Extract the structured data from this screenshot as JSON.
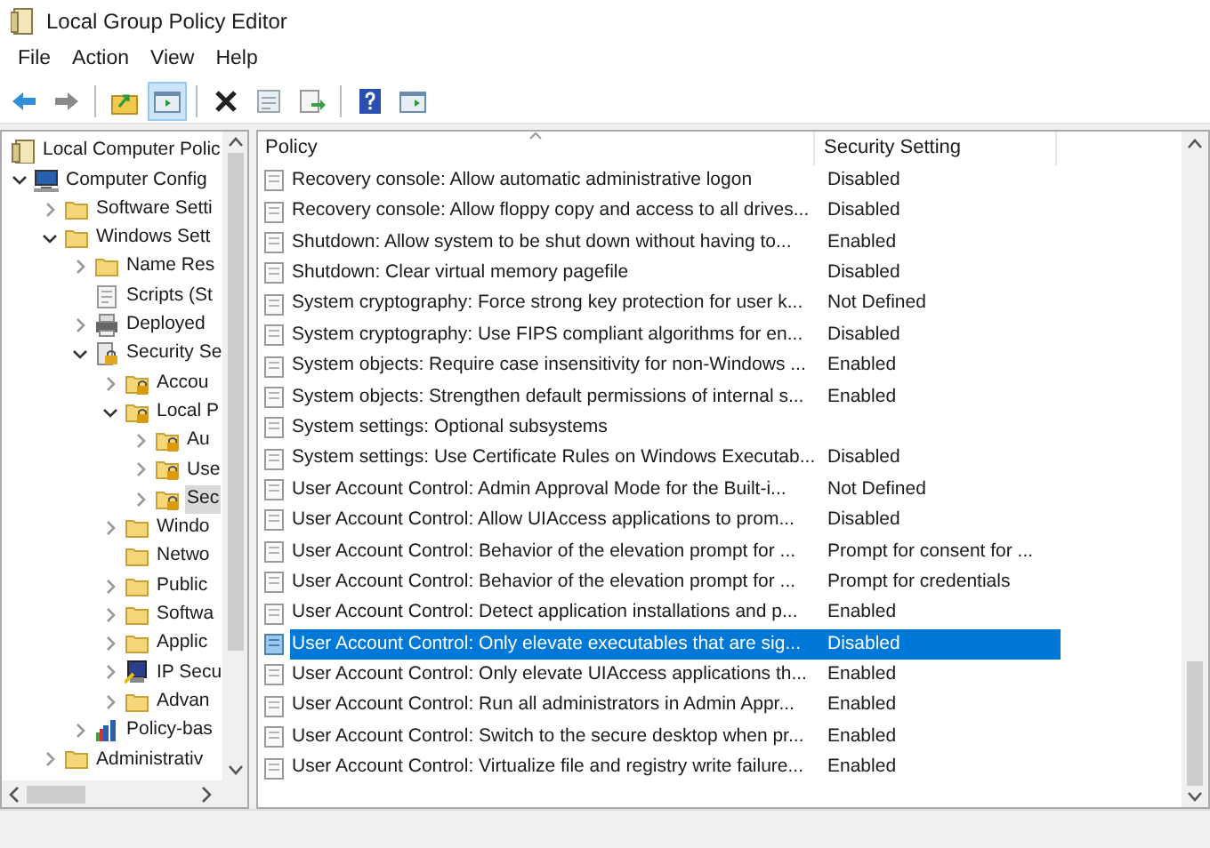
{
  "window": {
    "title": "Local Group Policy Editor"
  },
  "menu": [
    "File",
    "Action",
    "View",
    "Help"
  ],
  "toolbar": [
    {
      "kind": "back",
      "pressed": false
    },
    {
      "kind": "forward",
      "pressed": false
    },
    {
      "kind": "sep"
    },
    {
      "kind": "up",
      "pressed": false
    },
    {
      "kind": "tree",
      "pressed": true
    },
    {
      "kind": "sep"
    },
    {
      "kind": "delete",
      "pressed": false
    },
    {
      "kind": "properties",
      "pressed": false
    },
    {
      "kind": "export",
      "pressed": false
    },
    {
      "kind": "sep"
    },
    {
      "kind": "help",
      "pressed": false
    },
    {
      "kind": "action",
      "pressed": false
    }
  ],
  "tree": [
    {
      "label": "Local Computer Polic",
      "kind": "policy",
      "selected": false,
      "children": [
        {
          "label": "Computer Config",
          "kind": "computer",
          "expanded": true,
          "selected": false,
          "children": [
            {
              "label": "Software Setti",
              "kind": "folder",
              "expanded": false,
              "selected": false
            },
            {
              "label": "Windows Sett",
              "kind": "folder",
              "expanded": true,
              "selected": false,
              "children": [
                {
                  "label": "Name Res",
                  "kind": "folder",
                  "expanded": false,
                  "selected": false
                },
                {
                  "label": "Scripts (St",
                  "kind": "script",
                  "selected": false
                },
                {
                  "label": "Deployed",
                  "kind": "printer",
                  "expanded": false,
                  "selected": false
                },
                {
                  "label": "Security Se",
                  "kind": "security",
                  "expanded": true,
                  "selected": false,
                  "children": [
                    {
                      "label": "Accou",
                      "kind": "locked",
                      "expanded": false,
                      "selected": false
                    },
                    {
                      "label": "Local P",
                      "kind": "locked",
                      "expanded": true,
                      "selected": false,
                      "children": [
                        {
                          "label": "Au",
                          "kind": "locked",
                          "expanded": false,
                          "selected": false
                        },
                        {
                          "label": "Use",
                          "kind": "locked",
                          "expanded": false,
                          "selected": false
                        },
                        {
                          "label": "Sec",
                          "kind": "locked",
                          "expanded": false,
                          "selected": true
                        }
                      ]
                    },
                    {
                      "label": "Windo",
                      "kind": "folder",
                      "expanded": false,
                      "selected": false
                    },
                    {
                      "label": "Netwo",
                      "kind": "folder",
                      "selected": false
                    },
                    {
                      "label": "Public",
                      "kind": "folder",
                      "expanded": false,
                      "selected": false
                    },
                    {
                      "label": "Softwa",
                      "kind": "folder",
                      "expanded": false,
                      "selected": false
                    },
                    {
                      "label": "Applic",
                      "kind": "folder",
                      "expanded": false,
                      "selected": false
                    },
                    {
                      "label": "IP Secu",
                      "kind": "ip",
                      "expanded": false,
                      "selected": false
                    },
                    {
                      "label": "Advan",
                      "kind": "folder",
                      "expanded": false,
                      "selected": false
                    }
                  ]
                },
                {
                  "label": "Policy-bas",
                  "kind": "chart",
                  "expanded": false,
                  "selected": false
                }
              ]
            },
            {
              "label": "Administrativ",
              "kind": "folder",
              "expanded": false,
              "selected": false
            }
          ]
        }
      ]
    }
  ],
  "table": {
    "columns": [
      "Policy",
      "Security Setting"
    ],
    "rows": [
      {
        "policy": "Recovery console: Allow automatic administrative logon",
        "setting": "Disabled",
        "selected": false
      },
      {
        "policy": "Recovery console: Allow floppy copy and access to all drives...",
        "setting": "Disabled",
        "selected": false
      },
      {
        "policy": "Shutdown: Allow system to be shut down without having to...",
        "setting": "Enabled",
        "selected": false
      },
      {
        "policy": "Shutdown: Clear virtual memory pagefile",
        "setting": "Disabled",
        "selected": false
      },
      {
        "policy": "System cryptography: Force strong key protection for user k...",
        "setting": "Not Defined",
        "selected": false
      },
      {
        "policy": "System cryptography: Use FIPS compliant algorithms for en...",
        "setting": "Disabled",
        "selected": false
      },
      {
        "policy": "System objects: Require case insensitivity for non-Windows ...",
        "setting": "Enabled",
        "selected": false
      },
      {
        "policy": "System objects: Strengthen default permissions of internal s...",
        "setting": "Enabled",
        "selected": false
      },
      {
        "policy": "System settings: Optional subsystems",
        "selected": false
      },
      {
        "policy": "System settings: Use Certificate Rules on Windows Executab...",
        "setting": "Disabled",
        "selected": false
      },
      {
        "policy": "User Account Control: Admin Approval Mode for the Built-i...",
        "setting": "Not Defined",
        "selected": false
      },
      {
        "policy": "User Account Control: Allow UIAccess applications to prom...",
        "setting": "Disabled",
        "selected": false
      },
      {
        "policy": "User Account Control: Behavior of the elevation prompt for ...",
        "setting": "Prompt for consent for ...",
        "selected": false
      },
      {
        "policy": "User Account Control: Behavior of the elevation prompt for ...",
        "setting": "Prompt for credentials",
        "selected": false
      },
      {
        "policy": "User Account Control: Detect application installations and p...",
        "setting": "Enabled",
        "selected": false
      },
      {
        "policy": "User Account Control: Only elevate executables that are sig...",
        "setting": "Disabled",
        "selected": true
      },
      {
        "policy": "User Account Control: Only elevate UIAccess applications th...",
        "setting": "Enabled",
        "selected": false
      },
      {
        "policy": "User Account Control: Run all administrators in Admin Appr...",
        "setting": "Enabled",
        "selected": false
      },
      {
        "policy": "User Account Control: Switch to the secure desktop when pr...",
        "setting": "Enabled",
        "selected": false
      },
      {
        "policy": "User Account Control: Virtualize file and registry write failure...",
        "setting": "Enabled",
        "selected": false
      }
    ]
  }
}
